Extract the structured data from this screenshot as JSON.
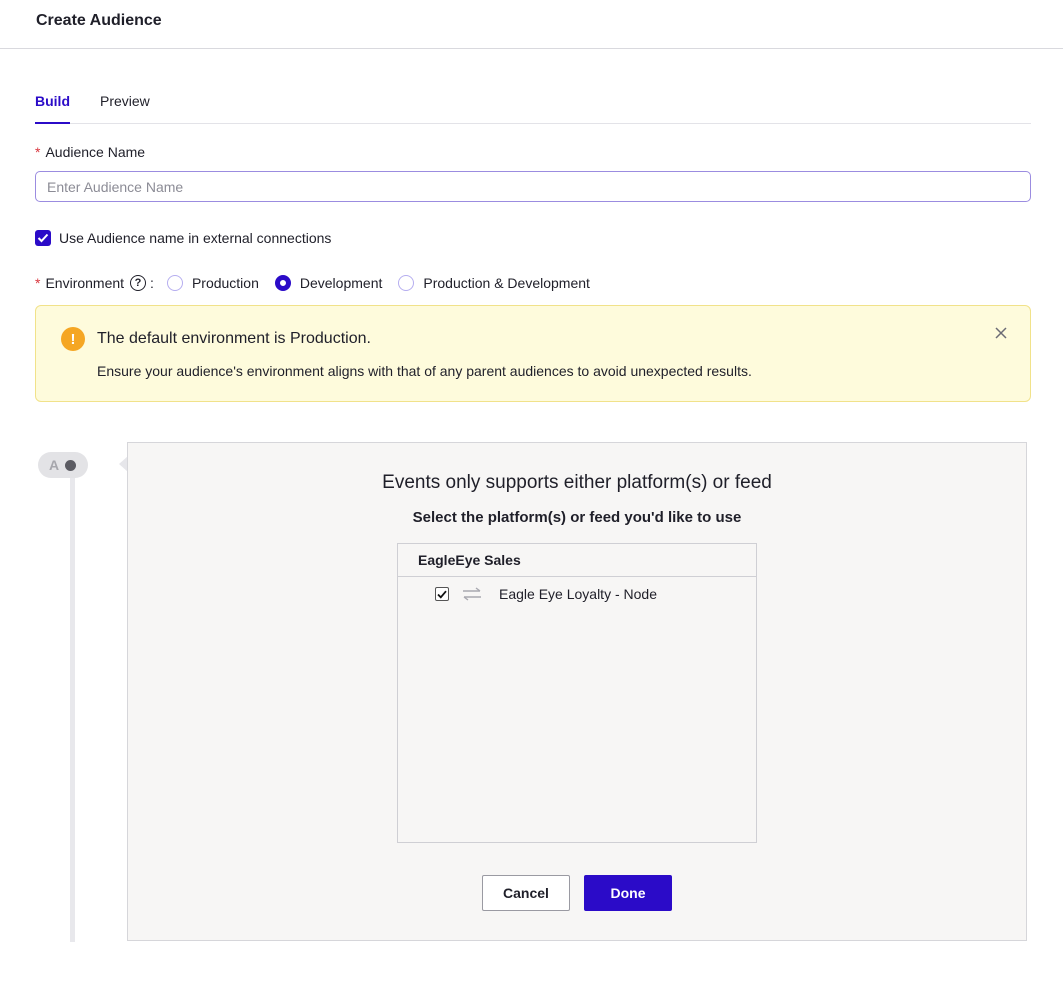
{
  "header": {
    "title": "Create Audience"
  },
  "tabs": [
    {
      "label": "Build",
      "active": true
    },
    {
      "label": "Preview",
      "active": false
    }
  ],
  "audience_name": {
    "label": "Audience Name",
    "required": true,
    "value": "",
    "placeholder": "Enter Audience Name"
  },
  "external_name": {
    "label": "Use Audience name in external connections",
    "checked": true
  },
  "environment": {
    "label": "Environment",
    "help_icon": "question-circle-icon",
    "options": [
      {
        "label": "Production",
        "selected": false
      },
      {
        "label": "Development",
        "selected": true
      },
      {
        "label": "Production & Development",
        "selected": false
      }
    ]
  },
  "alert": {
    "icon": "warning-icon",
    "title": "The default environment is Production.",
    "description": "Ensure your audience's environment aligns with that of any parent audiences to avoid unexpected results.",
    "close_icon": "close-icon"
  },
  "step": {
    "letter": "A"
  },
  "panel": {
    "title": "Events only supports either platform(s) or feed",
    "subtitle": "Select the platform(s) or feed you'd like to use",
    "list": {
      "header": "EagleEye Sales",
      "items": [
        {
          "label": "Eagle Eye Loyalty - Node",
          "checked": true,
          "icon": "sync-arrows-icon"
        }
      ]
    },
    "cancel_label": "Cancel",
    "done_label": "Done"
  },
  "colors": {
    "accent": "#2b0bc8",
    "warning": "#f5a623",
    "alert_bg": "#fefbdc"
  }
}
